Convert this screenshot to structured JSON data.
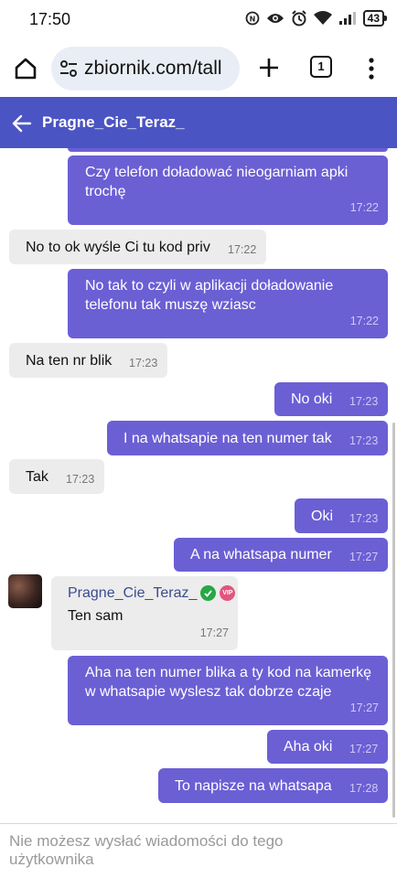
{
  "status_bar": {
    "time": "17:50",
    "battery": "43",
    "icons": [
      "nfc-icon",
      "eye-icon",
      "alarm-icon",
      "wifi-icon",
      "signal-icon",
      "battery-icon"
    ]
  },
  "browser": {
    "url": "zbiornik.com/tall",
    "tab_count": "1"
  },
  "chat": {
    "title": "Pragne_Cie_Teraz_",
    "messages": [
      {
        "dir": "sent",
        "text": "Czy telefon doładować nieogarniam apki trochę",
        "time": "17:22"
      },
      {
        "dir": "recv",
        "text": "No to ok wyśle Ci tu kod priv",
        "time": "17:22"
      },
      {
        "dir": "sent",
        "text": "No tak to czyli w aplikacji doładowanie telefonu tak muszę wziasc",
        "time": "17:22"
      },
      {
        "dir": "recv",
        "text": "Na ten nr blik",
        "time": "17:23"
      },
      {
        "dir": "sent",
        "text": "No oki",
        "time": "17:23"
      },
      {
        "dir": "sent",
        "text": "I na whatsapie na ten numer tak",
        "time": "17:23"
      },
      {
        "dir": "recv",
        "text": "Tak",
        "time": "17:23"
      },
      {
        "dir": "sent",
        "text": "Oki",
        "time": "17:23"
      },
      {
        "dir": "sent",
        "text": "A na whatsapa numer",
        "time": "17:27"
      },
      {
        "dir": "recv",
        "sender": "Pragne_Cie_Teraz_",
        "badge": "VIP",
        "text": "Ten sam",
        "time": "17:27"
      },
      {
        "dir": "sent",
        "text": "Aha na ten numer blika a ty kod na kamerkę w whatsapie wyslesz tak dobrze czaje",
        "time": "17:27"
      },
      {
        "dir": "sent",
        "text": "Aha oki",
        "time": "17:27"
      },
      {
        "dir": "sent",
        "text": "To napisze na whatsapa",
        "time": "17:28"
      }
    ]
  },
  "footer": {
    "notice": "Nie możesz wysłać wiadomości do tego użytkownika"
  },
  "colors": {
    "header": "#4a54c3",
    "sent_bubble": "#6b5fd4",
    "received_bubble": "#ececec",
    "sender_name": "#3b4c8f"
  }
}
